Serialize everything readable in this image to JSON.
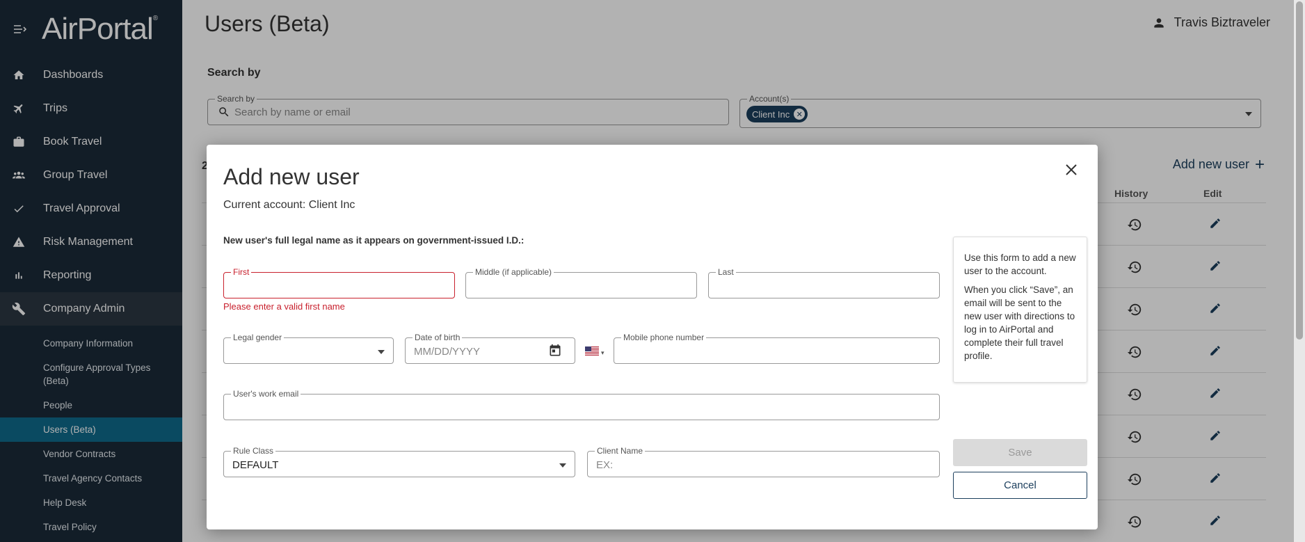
{
  "brand": {
    "name": "AirPortal",
    "trademark": "®"
  },
  "sidebar": {
    "items": [
      {
        "label": "Dashboards",
        "icon": "home-icon"
      },
      {
        "label": "Trips",
        "icon": "plane-icon"
      },
      {
        "label": "Book Travel",
        "icon": "briefcase-icon"
      },
      {
        "label": "Group Travel",
        "icon": "group-icon"
      },
      {
        "label": "Travel Approval",
        "icon": "check-icon"
      },
      {
        "label": "Risk Management",
        "icon": "warning-icon"
      },
      {
        "label": "Reporting",
        "icon": "bar-chart-icon"
      },
      {
        "label": "Company Admin",
        "icon": "wrench-icon"
      }
    ],
    "sub_items": [
      {
        "label": "Company Information"
      },
      {
        "label": "Configure Approval Types (Beta)"
      },
      {
        "label": "People"
      },
      {
        "label": "Users (Beta)"
      },
      {
        "label": "Vendor Contracts"
      },
      {
        "label": "Travel Agency Contacts"
      },
      {
        "label": "Help Desk"
      },
      {
        "label": "Travel Policy"
      }
    ]
  },
  "header": {
    "title": "Users (Beta)",
    "user_name": "Travis Biztraveler"
  },
  "search": {
    "section_label": "Search by",
    "field_label": "Search by",
    "placeholder": "Search by name or email",
    "account_label": "Account(s)",
    "account_chip": "Client Inc"
  },
  "table": {
    "count_prefix": "2",
    "add_new_user": "Add new user",
    "columns": {
      "history": "History",
      "edit": "Edit"
    }
  },
  "modal": {
    "title": "Add new user",
    "current_account": "Current account: Client Inc",
    "instruction": "New user's full legal name as it appears on government-issued I.D.:",
    "first_label": "First",
    "first_error": "Please enter a valid first name",
    "middle_label": "Middle (if applicable)",
    "last_label": "Last",
    "gender_label": "Legal gender",
    "dob_label": "Date of birth",
    "dob_placeholder": "MM/DD/YYYY",
    "mobile_label": "Mobile phone number",
    "email_label": "User's work email",
    "rule_class_label": "Rule Class",
    "rule_class_value": "DEFAULT",
    "client_name_label": "Client Name",
    "client_name_placeholder": "EX:",
    "info_p1": "Use this form to add a new user to the account.",
    "info_p2": "When you click “Save”, an email will be sent to the new user with directions to log in to AirPortal and complete their full travel profile.",
    "save_label": "Save",
    "cancel_label": "Cancel"
  },
  "colors": {
    "sidebar_bg": "#1b2a38",
    "active_sub_bg": "#0f6a8c",
    "accent": "#1b3e5c",
    "error": "#c8202d"
  }
}
